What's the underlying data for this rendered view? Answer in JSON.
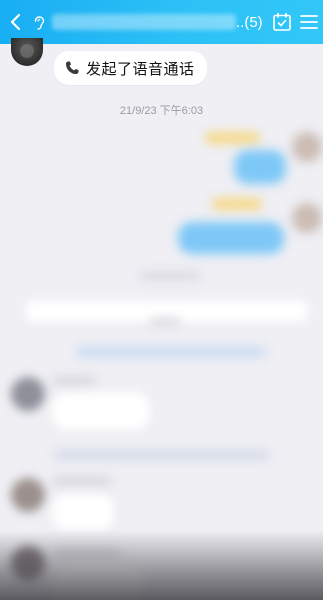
{
  "header": {
    "title_suffix": "..(5)",
    "back_icon": "chevron-left-icon",
    "ear_icon": "ear-icon",
    "calendar_icon": "calendar-check-icon",
    "menu_icon": "hamburger-menu-icon",
    "background_color": "#1fb5f5"
  },
  "messages": {
    "call_bubble_text": "发起了语音通话",
    "call_icon": "phone-icon",
    "timestamp": "21/9/23 下午6:03"
  },
  "colors": {
    "chat_background": "#efeff4",
    "sent_bubble": "#7ec8f7",
    "received_bubble": "#ffffff"
  }
}
